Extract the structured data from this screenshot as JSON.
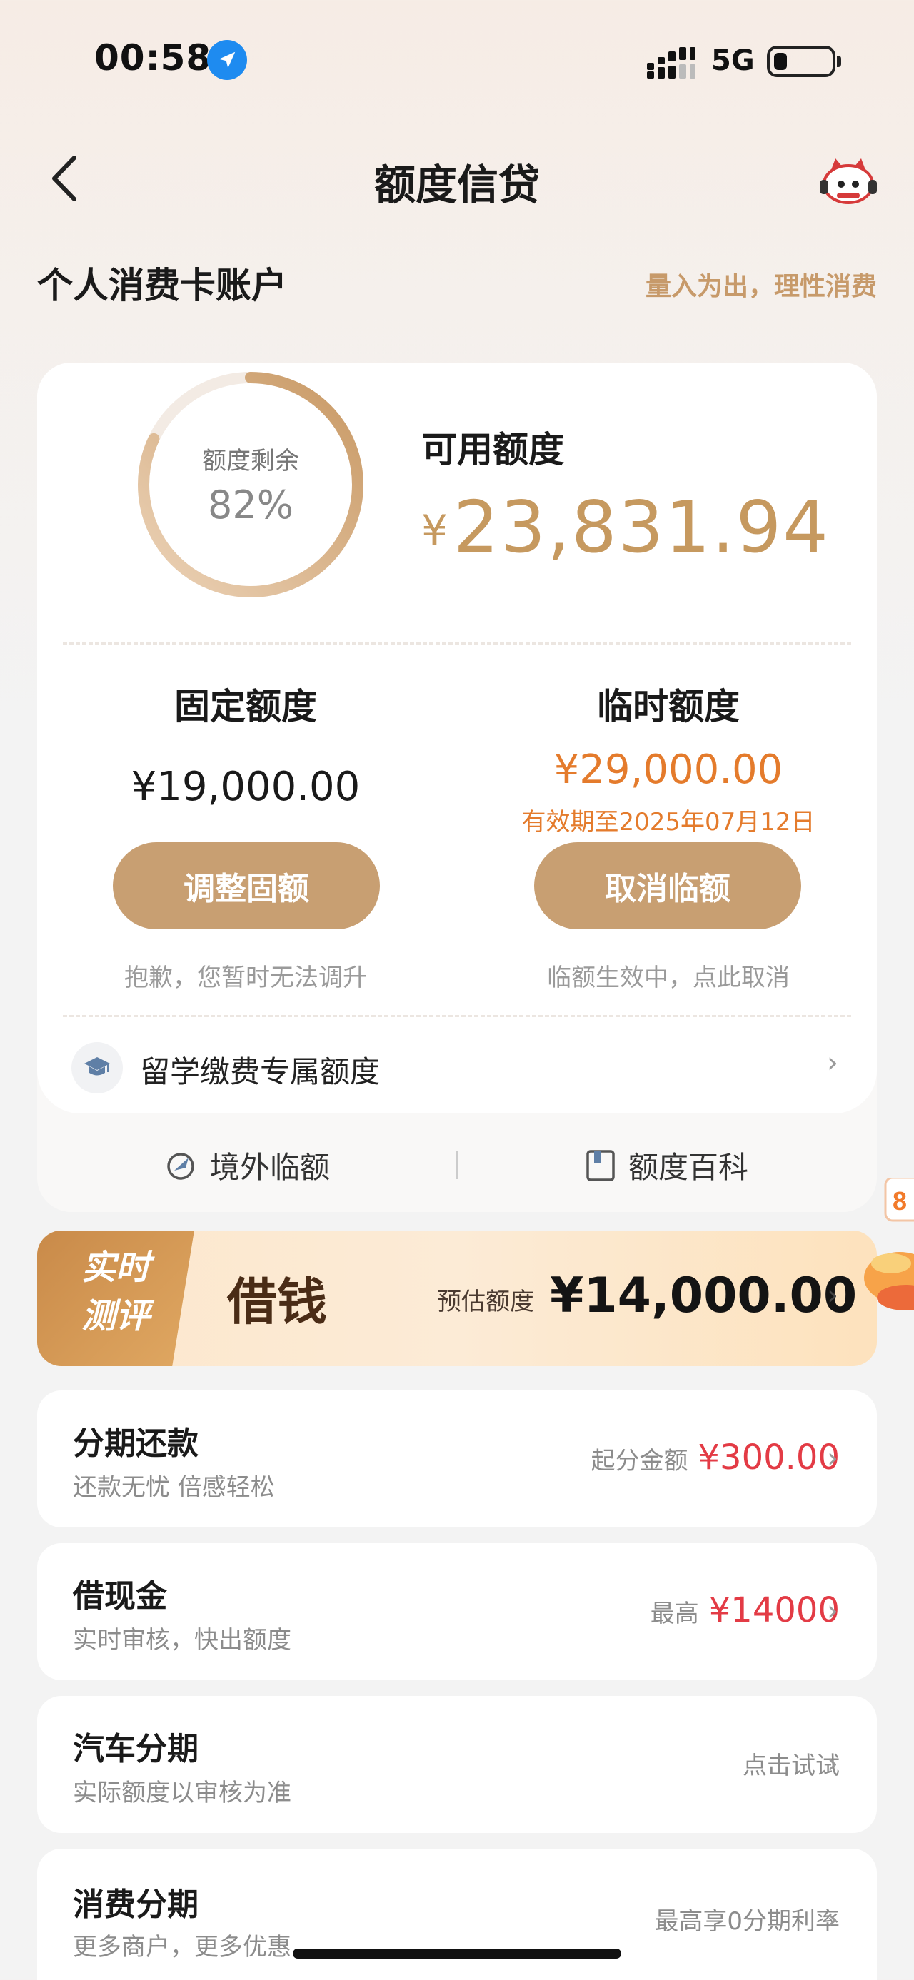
{
  "status_bar": {
    "time": "00:58",
    "network": "5G"
  },
  "nav": {
    "title": "额度信贷"
  },
  "section": {
    "title": "个人消费卡账户",
    "slogan": "量入为出，理性消费"
  },
  "credit_summary": {
    "ring_label": "额度剩余",
    "ring_value": "82%",
    "ring_fraction": 0.82,
    "available_label": "可用额度",
    "available_currency": "¥",
    "available_amount": "23,831.94"
  },
  "fixed_limit": {
    "title": "固定额度",
    "amount": "¥19,000.00",
    "button": "调整固额",
    "hint": "抱歉，您暂时无法调升"
  },
  "temp_limit": {
    "title": "临时额度",
    "amount": "¥29,000.00",
    "expiry": "有效期至2025年07月12日",
    "button": "取消临额",
    "hint": "临额生效中，点此取消"
  },
  "study_abroad": {
    "label": "留学缴费专属额度"
  },
  "tools": {
    "overseas": "境外临额",
    "wiki": "额度百科"
  },
  "banner": {
    "tag_line1": "实时",
    "tag_line2": "测评",
    "title": "借钱",
    "estimate_label": "预估额度",
    "estimate_amount": "¥14,000.00"
  },
  "list": [
    {
      "title": "分期还款",
      "subtitle": "还款无忧 倍感轻松",
      "right_label": "起分金额",
      "right_value": "¥300.00"
    },
    {
      "title": "借现金",
      "subtitle": "实时审核，快出额度",
      "right_label": "最高",
      "right_value": "¥14000"
    },
    {
      "title": "汽车分期",
      "subtitle": "实际额度以审核为准",
      "right_label": "点击试试",
      "right_value": ""
    },
    {
      "title": "消费分期",
      "subtitle": "更多商户，更多优惠",
      "right_label": "最高享0分期利率",
      "right_value": ""
    }
  ],
  "colors": {
    "accent_gold": "#c89f72",
    "amount_gold": "#c6995f",
    "temp_orange": "#e47b2c",
    "list_red": "#e33b45"
  }
}
